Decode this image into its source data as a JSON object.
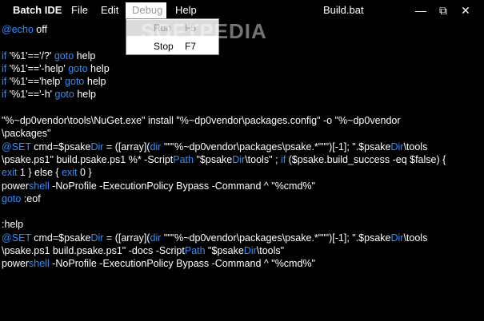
{
  "titlebar": {
    "app_name": "Batch IDE",
    "menus": [
      "File",
      "Edit",
      "Debug",
      "Help"
    ],
    "file_title": "Build.bat",
    "min_glyph": "—",
    "max_glyph": "⧉",
    "close_glyph": "✕"
  },
  "debug_menu": {
    "items": [
      {
        "label": "Run",
        "shortcut": "F5"
      },
      {
        "label": "Stop",
        "shortcut": "F7"
      }
    ]
  },
  "watermark": "SOFTPEDIA",
  "colors": {
    "background": "#000000",
    "text": "#ffffff",
    "keyword": "#2f8fff"
  },
  "code_lines": [
    [
      {
        "t": "@echo",
        "k": true
      },
      {
        "t": " off"
      }
    ],
    [],
    [
      {
        "t": "if",
        "k": true
      },
      {
        "t": " '%1'=='/?' "
      },
      {
        "t": "goto",
        "k": true
      },
      {
        "t": " help"
      }
    ],
    [
      {
        "t": "if",
        "k": true
      },
      {
        "t": " '%1'=='-help' "
      },
      {
        "t": "goto",
        "k": true
      },
      {
        "t": " help"
      }
    ],
    [
      {
        "t": "if",
        "k": true
      },
      {
        "t": " '%1'=='help' "
      },
      {
        "t": "goto",
        "k": true
      },
      {
        "t": " help"
      }
    ],
    [
      {
        "t": "if",
        "k": true
      },
      {
        "t": " '%1'=='-h' "
      },
      {
        "t": "goto",
        "k": true
      },
      {
        "t": " help"
      }
    ],
    [],
    [
      {
        "t": "\"%~dp0vendor\\tools\\NuGet.exe\" install \"%~dp0vendor\\packages.config\" -o \"%~dp0vendor"
      }
    ],
    [
      {
        "t": "\\packages\""
      }
    ],
    [
      {
        "t": "@SET",
        "k": true
      },
      {
        "t": " cmd=$psake"
      },
      {
        "t": "Dir",
        "k": true
      },
      {
        "t": " = ([array]("
      },
      {
        "t": "dir",
        "k": true
      },
      {
        "t": " \"\"\"%~dp0vendor\\packages\\psake.*\"\"\")[-1]; \".$psake"
      },
      {
        "t": "Dir",
        "k": true
      },
      {
        "t": "\\tools"
      }
    ],
    [
      {
        "t": "\\psake.ps1\" build.psake.ps1 %* -Script"
      },
      {
        "t": "Path",
        "k": true
      },
      {
        "t": " \"$psake"
      },
      {
        "t": "Dir",
        "k": true
      },
      {
        "t": "\\tools\" ; "
      },
      {
        "t": "if",
        "k": true
      },
      {
        "t": " ($psake.build_success -eq $false) {"
      }
    ],
    [
      {
        "t": "exit",
        "k": true
      },
      {
        "t": " 1 } else { "
      },
      {
        "t": "exit",
        "k": true
      },
      {
        "t": " 0 }"
      }
    ],
    [
      {
        "t": "power"
      },
      {
        "t": "shell",
        "k": true
      },
      {
        "t": " -NoProfile -ExecutionPolicy Bypass -Command ^ \"%cmd%\""
      }
    ],
    [
      {
        "t": "goto",
        "k": true
      },
      {
        "t": " :eof"
      }
    ],
    [],
    [
      {
        "t": ":help"
      }
    ],
    [
      {
        "t": "@SET",
        "k": true
      },
      {
        "t": " cmd=$psake"
      },
      {
        "t": "Dir",
        "k": true
      },
      {
        "t": " = ([array]("
      },
      {
        "t": "dir",
        "k": true
      },
      {
        "t": " \"\"\"%~dp0vendor\\packages\\psake.*\"\"\")[-1]; \".$psake"
      },
      {
        "t": "Dir",
        "k": true
      },
      {
        "t": "\\tools"
      }
    ],
    [
      {
        "t": "\\psake.ps1 build.psake.ps1\" -docs -Script"
      },
      {
        "t": "Path",
        "k": true
      },
      {
        "t": " \"$psake"
      },
      {
        "t": "Dir",
        "k": true
      },
      {
        "t": "\\tools\""
      }
    ],
    [
      {
        "t": "power"
      },
      {
        "t": "shell",
        "k": true
      },
      {
        "t": " -NoProfile -ExecutionPolicy Bypass -Command ^ \"%cmd%\""
      }
    ]
  ]
}
